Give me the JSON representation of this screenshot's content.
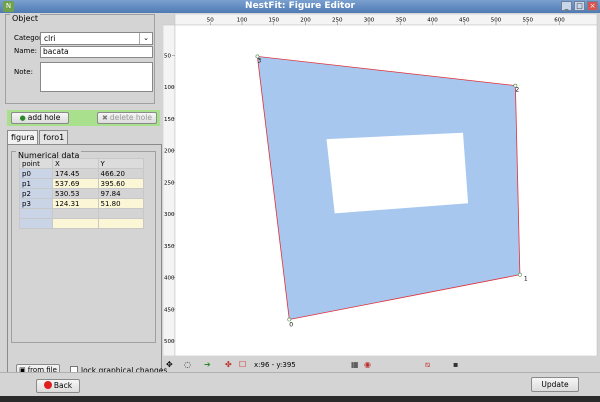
{
  "window": {
    "title": "NestFit: Figure Editor",
    "icon": "nestfit-app-icon",
    "buttons": [
      "_",
      "□",
      "×"
    ]
  },
  "object_panel": {
    "legend": "Object",
    "category_label": "Category",
    "category_value": "clri",
    "name_label": "Name:",
    "name_value": "bacata",
    "note_label": "Note:",
    "note_value": ""
  },
  "hole_buttons": {
    "add_label": "add hole",
    "delete_label": "delete hole"
  },
  "tabs": [
    {
      "label": "figura",
      "active": true
    },
    {
      "label": "foro1",
      "active": false
    }
  ],
  "numerical_data": {
    "legend": "Numerical data",
    "columns": [
      "point",
      "X",
      "Y"
    ],
    "rows": [
      {
        "point": "p0",
        "x": "174.45",
        "y": "466.20"
      },
      {
        "point": "p1",
        "x": "537.69",
        "y": "395.60"
      },
      {
        "point": "p2",
        "x": "530.53",
        "y": "97.84"
      },
      {
        "point": "p3",
        "x": "124.31",
        "y": "51.80"
      }
    ]
  },
  "from_file_label": "from file",
  "lock_label": "lock graphical changes",
  "ruler": {
    "x_ticks": [
      "50",
      "100",
      "150",
      "200",
      "250",
      "300",
      "350",
      "400",
      "450",
      "500",
      "550",
      "600"
    ],
    "y_ticks": [
      "50",
      "100",
      "150",
      "200",
      "250",
      "300",
      "350",
      "400",
      "450",
      "500"
    ]
  },
  "figure": {
    "outer": [
      {
        "x": 174.45,
        "y": 466.2
      },
      {
        "x": 537.69,
        "y": 395.6
      },
      {
        "x": 530.53,
        "y": 97.84
      },
      {
        "x": 124.31,
        "y": 51.8
      }
    ],
    "vertex_labels": [
      "0",
      "1",
      "2",
      "3"
    ],
    "hole": [
      {
        "x": 233,
        "y": 182
      },
      {
        "x": 448,
        "y": 172
      },
      {
        "x": 456,
        "y": 283
      },
      {
        "x": 246,
        "y": 299
      }
    ],
    "fill_color": "#a7c7ee",
    "edge_color": "#e0303a",
    "hole_color": "#ffffff"
  },
  "bottom_toolbar": {
    "coords": "x:96 - y:395",
    "icons": [
      "move-icon",
      "circle-icon",
      "rotate-icon",
      "vertex-icon",
      "rect-icon",
      "image-icon",
      "eye-icon",
      "mirror-icon",
      "save-icon"
    ]
  },
  "footer": {
    "back_label": "Back",
    "update_label": "Update"
  }
}
